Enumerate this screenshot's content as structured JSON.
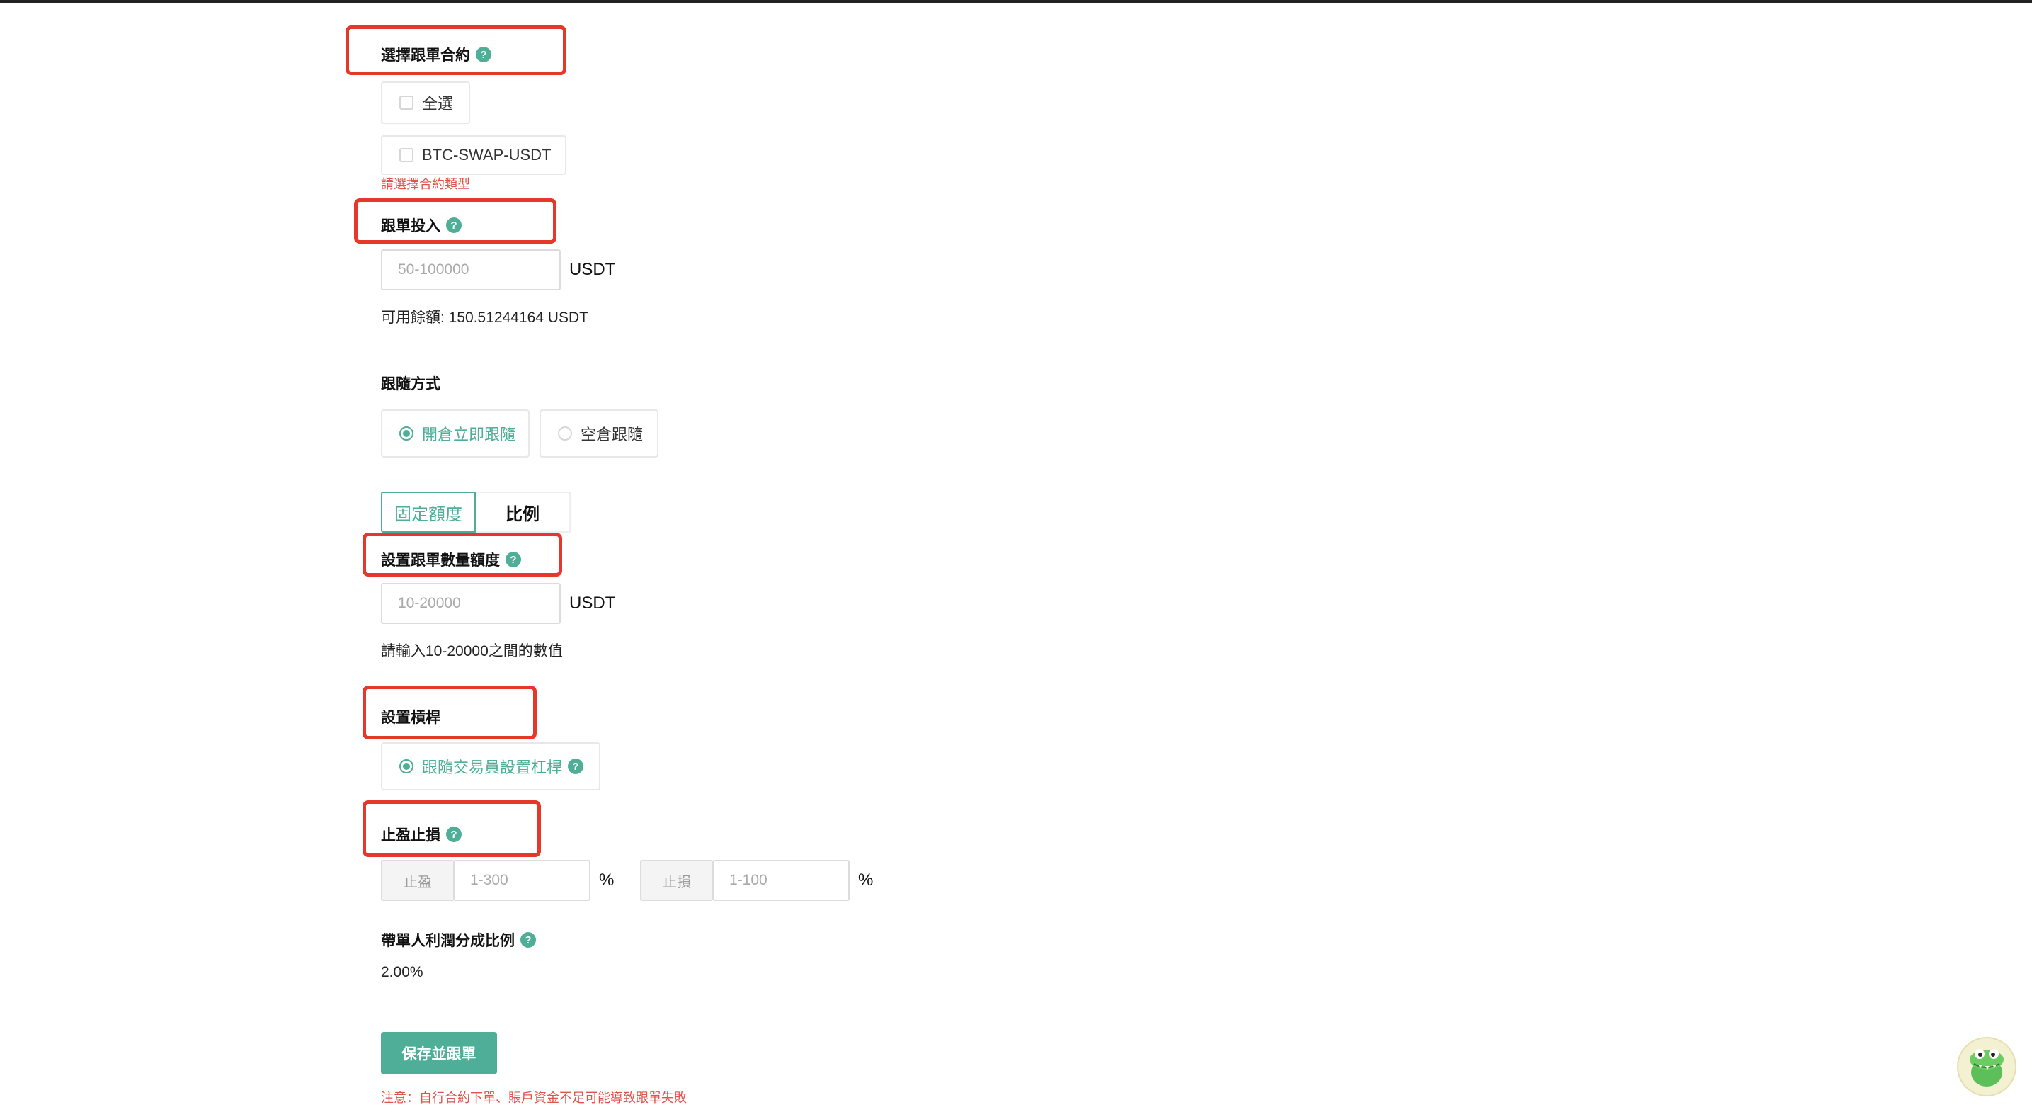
{
  "sections": {
    "contract": {
      "title": "選擇跟單合約",
      "select_all": "全選",
      "option": "BTC-SWAP-USDT",
      "error": "請選擇合約類型"
    },
    "investment": {
      "title": "跟單投入",
      "placeholder": "50-100000",
      "unit": "USDT",
      "balance": "可用餘額: 150.51244164 USDT"
    },
    "follow_mode": {
      "title": "跟隨方式",
      "option_on": "開倉立即跟隨",
      "option_off": "空倉跟隨"
    },
    "amount_tabs": {
      "fixed": "固定額度",
      "ratio": "比例"
    },
    "amount": {
      "title": "設置跟單數量額度",
      "placeholder": "10-20000",
      "unit": "USDT",
      "hint": "請輸入10-20000之間的數值"
    },
    "leverage": {
      "title": "設置槓桿",
      "option": "跟隨交易員設置杠桿"
    },
    "tpsl": {
      "title": "止盈止損",
      "tp_label": "止盈",
      "tp_placeholder": "1-300",
      "tp_unit": "%",
      "sl_label": "止損",
      "sl_placeholder": "1-100",
      "sl_unit": "%"
    },
    "profit_share": {
      "title": "帶單人利潤分成比例",
      "value": "2.00%"
    }
  },
  "actions": {
    "save_button": "保存並跟單",
    "notice": "注意：自行合約下單、賬戶資金不足可能導致跟單失敗"
  },
  "help_icon_glyph": "?",
  "colors": {
    "accent": "#4fae97",
    "highlight_box": "#e6382a",
    "error": "#e0534b"
  }
}
